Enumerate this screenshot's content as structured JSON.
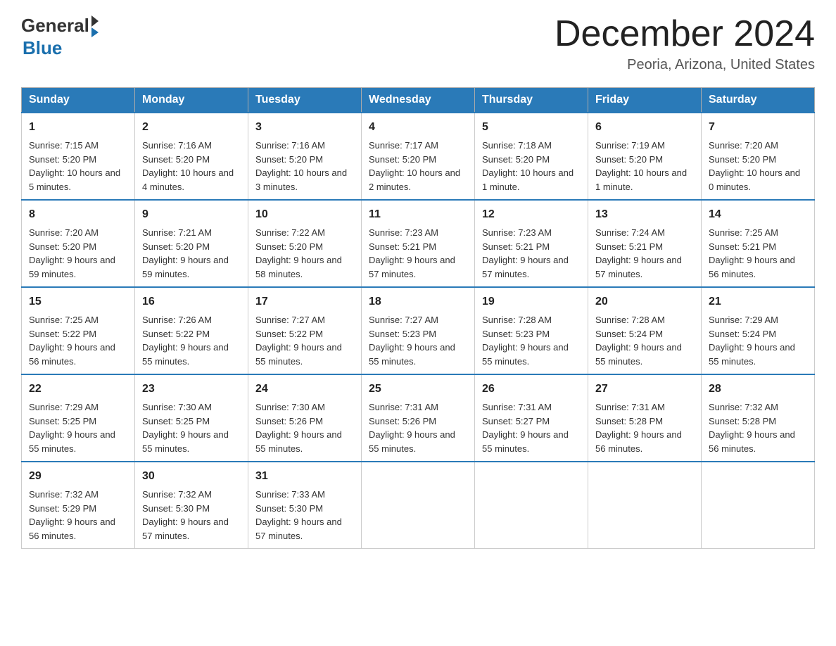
{
  "logo": {
    "text_general": "General",
    "text_blue": "Blue"
  },
  "header": {
    "title": "December 2024",
    "subtitle": "Peoria, Arizona, United States"
  },
  "days_of_week": [
    "Sunday",
    "Monday",
    "Tuesday",
    "Wednesday",
    "Thursday",
    "Friday",
    "Saturday"
  ],
  "weeks": [
    [
      {
        "day": "1",
        "sunrise": "7:15 AM",
        "sunset": "5:20 PM",
        "daylight": "10 hours and 5 minutes."
      },
      {
        "day": "2",
        "sunrise": "7:16 AM",
        "sunset": "5:20 PM",
        "daylight": "10 hours and 4 minutes."
      },
      {
        "day": "3",
        "sunrise": "7:16 AM",
        "sunset": "5:20 PM",
        "daylight": "10 hours and 3 minutes."
      },
      {
        "day": "4",
        "sunrise": "7:17 AM",
        "sunset": "5:20 PM",
        "daylight": "10 hours and 2 minutes."
      },
      {
        "day": "5",
        "sunrise": "7:18 AM",
        "sunset": "5:20 PM",
        "daylight": "10 hours and 1 minute."
      },
      {
        "day": "6",
        "sunrise": "7:19 AM",
        "sunset": "5:20 PM",
        "daylight": "10 hours and 1 minute."
      },
      {
        "day": "7",
        "sunrise": "7:20 AM",
        "sunset": "5:20 PM",
        "daylight": "10 hours and 0 minutes."
      }
    ],
    [
      {
        "day": "8",
        "sunrise": "7:20 AM",
        "sunset": "5:20 PM",
        "daylight": "9 hours and 59 minutes."
      },
      {
        "day": "9",
        "sunrise": "7:21 AM",
        "sunset": "5:20 PM",
        "daylight": "9 hours and 59 minutes."
      },
      {
        "day": "10",
        "sunrise": "7:22 AM",
        "sunset": "5:20 PM",
        "daylight": "9 hours and 58 minutes."
      },
      {
        "day": "11",
        "sunrise": "7:23 AM",
        "sunset": "5:21 PM",
        "daylight": "9 hours and 57 minutes."
      },
      {
        "day": "12",
        "sunrise": "7:23 AM",
        "sunset": "5:21 PM",
        "daylight": "9 hours and 57 minutes."
      },
      {
        "day": "13",
        "sunrise": "7:24 AM",
        "sunset": "5:21 PM",
        "daylight": "9 hours and 57 minutes."
      },
      {
        "day": "14",
        "sunrise": "7:25 AM",
        "sunset": "5:21 PM",
        "daylight": "9 hours and 56 minutes."
      }
    ],
    [
      {
        "day": "15",
        "sunrise": "7:25 AM",
        "sunset": "5:22 PM",
        "daylight": "9 hours and 56 minutes."
      },
      {
        "day": "16",
        "sunrise": "7:26 AM",
        "sunset": "5:22 PM",
        "daylight": "9 hours and 55 minutes."
      },
      {
        "day": "17",
        "sunrise": "7:27 AM",
        "sunset": "5:22 PM",
        "daylight": "9 hours and 55 minutes."
      },
      {
        "day": "18",
        "sunrise": "7:27 AM",
        "sunset": "5:23 PM",
        "daylight": "9 hours and 55 minutes."
      },
      {
        "day": "19",
        "sunrise": "7:28 AM",
        "sunset": "5:23 PM",
        "daylight": "9 hours and 55 minutes."
      },
      {
        "day": "20",
        "sunrise": "7:28 AM",
        "sunset": "5:24 PM",
        "daylight": "9 hours and 55 minutes."
      },
      {
        "day": "21",
        "sunrise": "7:29 AM",
        "sunset": "5:24 PM",
        "daylight": "9 hours and 55 minutes."
      }
    ],
    [
      {
        "day": "22",
        "sunrise": "7:29 AM",
        "sunset": "5:25 PM",
        "daylight": "9 hours and 55 minutes."
      },
      {
        "day": "23",
        "sunrise": "7:30 AM",
        "sunset": "5:25 PM",
        "daylight": "9 hours and 55 minutes."
      },
      {
        "day": "24",
        "sunrise": "7:30 AM",
        "sunset": "5:26 PM",
        "daylight": "9 hours and 55 minutes."
      },
      {
        "day": "25",
        "sunrise": "7:31 AM",
        "sunset": "5:26 PM",
        "daylight": "9 hours and 55 minutes."
      },
      {
        "day": "26",
        "sunrise": "7:31 AM",
        "sunset": "5:27 PM",
        "daylight": "9 hours and 55 minutes."
      },
      {
        "day": "27",
        "sunrise": "7:31 AM",
        "sunset": "5:28 PM",
        "daylight": "9 hours and 56 minutes."
      },
      {
        "day": "28",
        "sunrise": "7:32 AM",
        "sunset": "5:28 PM",
        "daylight": "9 hours and 56 minutes."
      }
    ],
    [
      {
        "day": "29",
        "sunrise": "7:32 AM",
        "sunset": "5:29 PM",
        "daylight": "9 hours and 56 minutes."
      },
      {
        "day": "30",
        "sunrise": "7:32 AM",
        "sunset": "5:30 PM",
        "daylight": "9 hours and 57 minutes."
      },
      {
        "day": "31",
        "sunrise": "7:33 AM",
        "sunset": "5:30 PM",
        "daylight": "9 hours and 57 minutes."
      },
      null,
      null,
      null,
      null
    ]
  ],
  "labels": {
    "sunrise": "Sunrise:",
    "sunset": "Sunset:",
    "daylight": "Daylight:"
  }
}
